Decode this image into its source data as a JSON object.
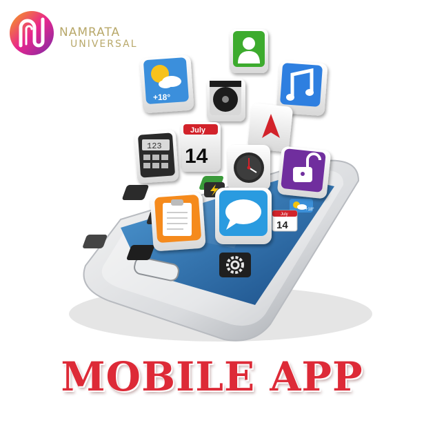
{
  "logo": {
    "line1": "NAMRATA",
    "line2": "UNIVERSAL",
    "colors": {
      "brand_text": "#b8a86a",
      "gradient_start": "#f7a21a",
      "gradient_mid": "#e8268c",
      "gradient_end": "#7b2aa8"
    }
  },
  "icons": {
    "weather_temp": "+18°",
    "calendar_month": "July",
    "calendar_day": "14",
    "calculator_display": "123",
    "small_weather_temp": "+18°",
    "small_calendar_month": "July",
    "small_calendar_day": "14"
  },
  "headline": "MOBILE APP",
  "colors": {
    "headline": "#dd2a37"
  }
}
